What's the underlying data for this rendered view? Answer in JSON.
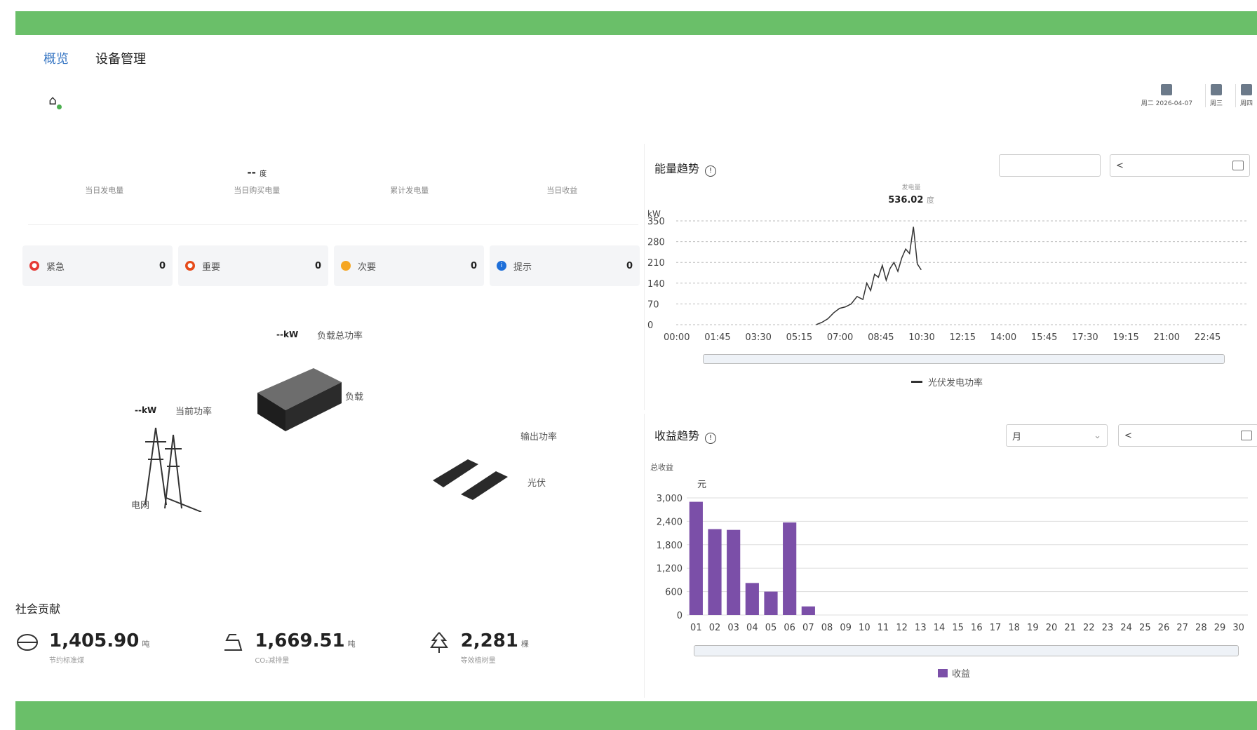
{
  "nav": {
    "tabs": [
      {
        "label": "概览",
        "active": true
      },
      {
        "label": "设备管理",
        "active": false
      }
    ]
  },
  "header": {
    "icon": "home-icon"
  },
  "weather": {
    "days": [
      {
        "label": "周二 2026-04-07",
        "icon": "weather-icon"
      },
      {
        "label": "周三",
        "icon": "weather-icon"
      },
      {
        "label": "周四",
        "icon": "weather-icon"
      }
    ]
  },
  "stats": [
    {
      "value": "",
      "unit": "",
      "label": "当日发电量"
    },
    {
      "value": "--",
      "unit": "度",
      "label": "当日购买电量"
    },
    {
      "value": "",
      "unit": "",
      "label": "累计发电量"
    },
    {
      "value": "",
      "unit": "",
      "label": "当日收益"
    }
  ],
  "alarms": [
    {
      "name": "紧急",
      "count": "0",
      "color": "#e53935",
      "icon": "critical-icon"
    },
    {
      "name": "重要",
      "count": "0",
      "color": "#e64a19",
      "icon": "major-icon"
    },
    {
      "name": "次要",
      "count": "0",
      "color": "#f5a623",
      "icon": "minor-icon"
    },
    {
      "name": "提示",
      "count": "0",
      "color": "#1e6fd9",
      "icon": "info-icon"
    }
  ],
  "flow": {
    "load_power_value": "--kW",
    "load_power_label": "负载总功率",
    "load_label": "负载",
    "grid_power_value": "--kW",
    "grid_power_label": "当前功率",
    "grid_label": "电网",
    "output_label": "输出功率",
    "pv_label": "光伏"
  },
  "social": {
    "title": "社会贡献",
    "items": [
      {
        "value": "1,405.90",
        "unit": "吨",
        "label": "节约标准煤",
        "icon": "coal-icon"
      },
      {
        "value": "1,669.51",
        "unit": "吨",
        "label": "CO₂减排量",
        "icon": "co2-icon"
      },
      {
        "value": "2,281",
        "unit": "棵",
        "label": "等效植树量",
        "icon": "tree-icon"
      }
    ]
  },
  "energy_panel": {
    "title": "能量趋势",
    "peak_label": "发电量",
    "peak_value": "536.02",
    "peak_unit": "度",
    "legend": "光伏发电功率",
    "date_prev": "<"
  },
  "revenue_panel": {
    "title": "收益趋势",
    "period_select": "月",
    "total_label": "总收益",
    "legend": "收益",
    "date_prev": "<"
  },
  "chart_data": [
    {
      "type": "line",
      "name": "energy-trend",
      "ylabel": "kW",
      "ylim": [
        0,
        350
      ],
      "yticks": [
        0,
        70,
        140,
        210,
        280,
        350
      ],
      "xticks": [
        "00:00",
        "01:45",
        "03:30",
        "05:15",
        "07:00",
        "08:45",
        "10:30",
        "12:15",
        "14:00",
        "15:45",
        "17:30",
        "19:15",
        "21:00",
        "22:45"
      ],
      "grid": true,
      "legend_position": "bottom",
      "series": [
        {
          "name": "光伏发电功率",
          "color": "#333333",
          "x": [
            "06:00",
            "06:15",
            "06:30",
            "06:45",
            "07:00",
            "07:15",
            "07:30",
            "07:45",
            "08:00",
            "08:10",
            "08:20",
            "08:30",
            "08:40",
            "08:50",
            "09:00",
            "09:10",
            "09:20",
            "09:30",
            "09:40",
            "09:50",
            "10:00",
            "10:10",
            "10:20",
            "10:30"
          ],
          "y": [
            0,
            8,
            20,
            40,
            55,
            60,
            70,
            95,
            85,
            140,
            115,
            170,
            160,
            200,
            150,
            190,
            210,
            180,
            225,
            255,
            240,
            330,
            205,
            185
          ]
        }
      ]
    },
    {
      "type": "bar",
      "name": "revenue-trend",
      "ylabel": "元",
      "ylim": [
        0,
        3000
      ],
      "yticks": [
        0,
        600,
        1200,
        1800,
        2400,
        3000
      ],
      "categories": [
        "01",
        "02",
        "03",
        "04",
        "05",
        "06",
        "07",
        "08",
        "09",
        "10",
        "11",
        "12",
        "13",
        "14",
        "15",
        "16",
        "17",
        "18",
        "19",
        "20",
        "21",
        "22",
        "23",
        "24",
        "25",
        "26",
        "27",
        "28",
        "29",
        "30"
      ],
      "grid": true,
      "legend_position": "bottom",
      "series": [
        {
          "name": "收益",
          "color": "#7b4fa8",
          "values": [
            2900,
            2200,
            2180,
            820,
            600,
            2370,
            220,
            0,
            0,
            0,
            0,
            0,
            0,
            0,
            0,
            0,
            0,
            0,
            0,
            0,
            0,
            0,
            0,
            0,
            0,
            0,
            0,
            0,
            0,
            0
          ]
        }
      ]
    }
  ]
}
